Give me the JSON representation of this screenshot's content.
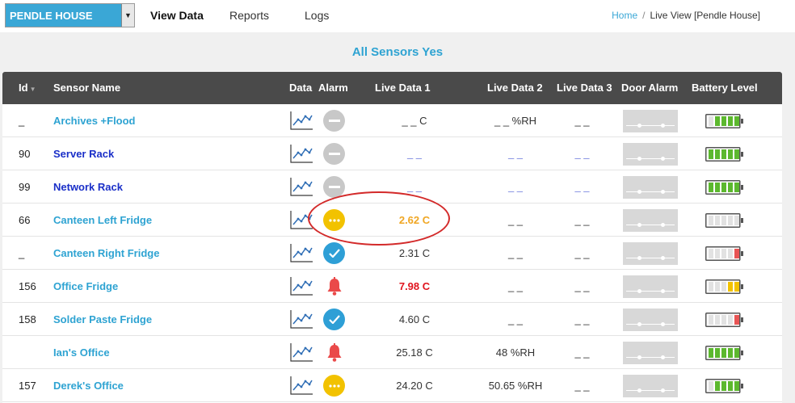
{
  "header": {
    "site": "PENDLE HOUSE",
    "nav": [
      {
        "label": "View Data",
        "active": true
      },
      {
        "label": "Reports",
        "active": false
      },
      {
        "label": "Logs",
        "active": false
      }
    ],
    "breadcrumb": {
      "home": "Home",
      "current": "Live View [Pendle House]"
    }
  },
  "page": {
    "subtitle": "All Sensors Yes"
  },
  "table": {
    "columns": {
      "id": "Id",
      "name": "Sensor Name",
      "data": "Data",
      "alarm": "Alarm",
      "live1": "Live Data 1",
      "live2": "Live Data 2",
      "live3": "Live Data 3",
      "door": "Door Alarm",
      "battery": "Battery Level"
    },
    "rows": [
      {
        "id": "_",
        "name": "Archives +Flood",
        "alarm": "disabled",
        "live1": "_ _ C",
        "live2": "_ _ %RH",
        "live3": "_ _",
        "battery": {
          "level": 4,
          "color": "#5cb82e"
        }
      },
      {
        "id": "90",
        "name": "Server Rack",
        "alarm": "disabled",
        "live1": "_ _",
        "live2": "_ _",
        "live3": "_ _",
        "battery": {
          "level": 5,
          "color": "#5cb82e"
        }
      },
      {
        "id": "99",
        "name": "Network Rack",
        "alarm": "disabled",
        "live1": "_ _",
        "live2": "_ _",
        "live3": "_ _",
        "battery": {
          "level": 5,
          "color": "#5cb82e"
        }
      },
      {
        "id": "66",
        "name": "Canteen Left Fridge",
        "alarm": "pending",
        "live1": "2.62 C",
        "live2": "_ _",
        "live3": "_ _",
        "battery": {
          "level": 0,
          "color": "#d0d0d0"
        }
      },
      {
        "id": "_",
        "name": "Canteen Right Fridge",
        "alarm": "ok",
        "live1": "2.31 C",
        "live2": "_ _",
        "live3": "_ _",
        "battery": {
          "level": 1,
          "color": "#e85454"
        }
      },
      {
        "id": "156",
        "name": "Office Fridge",
        "alarm": "bell",
        "live1": "7.98 C",
        "live2": "_ _",
        "live3": "_ _",
        "battery": {
          "level": 2,
          "color": "#f2c200"
        }
      },
      {
        "id": "158",
        "name": "Solder Paste Fridge",
        "alarm": "ok",
        "live1": "4.60 C",
        "live2": "_ _",
        "live3": "_ _",
        "battery": {
          "level": 1,
          "color": "#e85454"
        }
      },
      {
        "id": "",
        "name": "Ian's Office",
        "alarm": "bell",
        "live1": "25.18 C",
        "live2": "48 %RH",
        "live3": "_ _",
        "battery": {
          "level": 5,
          "color": "#5cb82e"
        }
      },
      {
        "id": "157",
        "name": "Derek's Office",
        "alarm": "pending",
        "live1": "24.20 C",
        "live2": "50.65 %RH",
        "live3": "_ _",
        "battery": {
          "level": 4,
          "color": "#5cb82e"
        }
      }
    ]
  },
  "colors": {
    "accent": "#2ea3d2",
    "header_bg": "#4a4a4a",
    "link_dark": "#1a2fc8",
    "warning": "#f2c200",
    "alarm_red": "#e85454",
    "ok_blue": "#2e9fd6",
    "annotation": "#d32a2a"
  }
}
